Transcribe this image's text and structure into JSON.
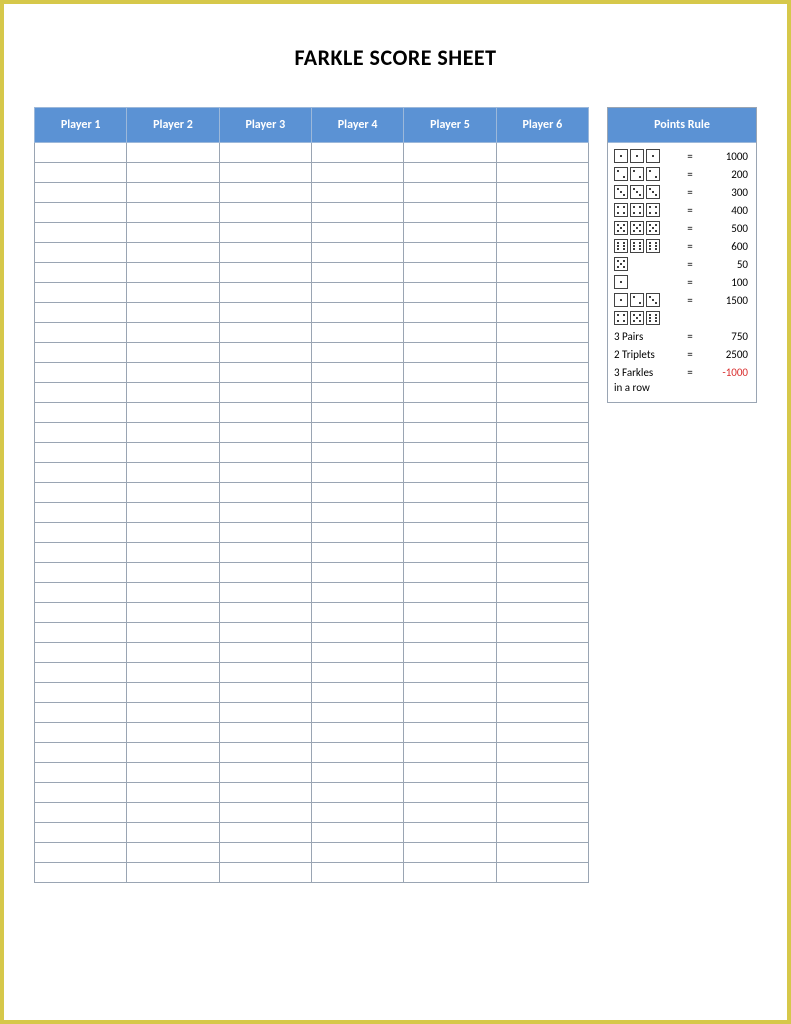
{
  "title": "FARKLE SCORE SHEET",
  "players": [
    "Player 1",
    "Player 2",
    "Player 3",
    "Player 4",
    "Player 5",
    "Player 6"
  ],
  "score_rows": 37,
  "rules_header": "Points Rule",
  "rules": [
    {
      "dice": [
        1,
        1,
        1
      ],
      "eq": "=",
      "value": "1000"
    },
    {
      "dice": [
        2,
        2,
        2
      ],
      "eq": "=",
      "value": "200"
    },
    {
      "dice": [
        3,
        3,
        3
      ],
      "eq": "=",
      "value": "300"
    },
    {
      "dice": [
        4,
        4,
        4
      ],
      "eq": "=",
      "value": "400"
    },
    {
      "dice": [
        5,
        5,
        5
      ],
      "eq": "=",
      "value": "500"
    },
    {
      "dice": [
        6,
        6,
        6
      ],
      "eq": "=",
      "value": "600"
    },
    {
      "dice": [
        5
      ],
      "eq": "=",
      "value": "50"
    },
    {
      "dice": [
        1
      ],
      "eq": "=",
      "value": "100"
    },
    {
      "dice": [
        1,
        2,
        3
      ],
      "eq": "=",
      "value": "1500"
    },
    {
      "dice": [
        4,
        5,
        6
      ],
      "eq": "",
      "value": ""
    },
    {
      "label": "3 Pairs",
      "eq": "=",
      "value": "750"
    },
    {
      "label": "2 Triplets",
      "eq": "=",
      "value": "2500"
    },
    {
      "label": "3 Farkles",
      "eq": "=",
      "value": "-1000",
      "neg": true,
      "sub": "in a row"
    }
  ],
  "watermark": ""
}
